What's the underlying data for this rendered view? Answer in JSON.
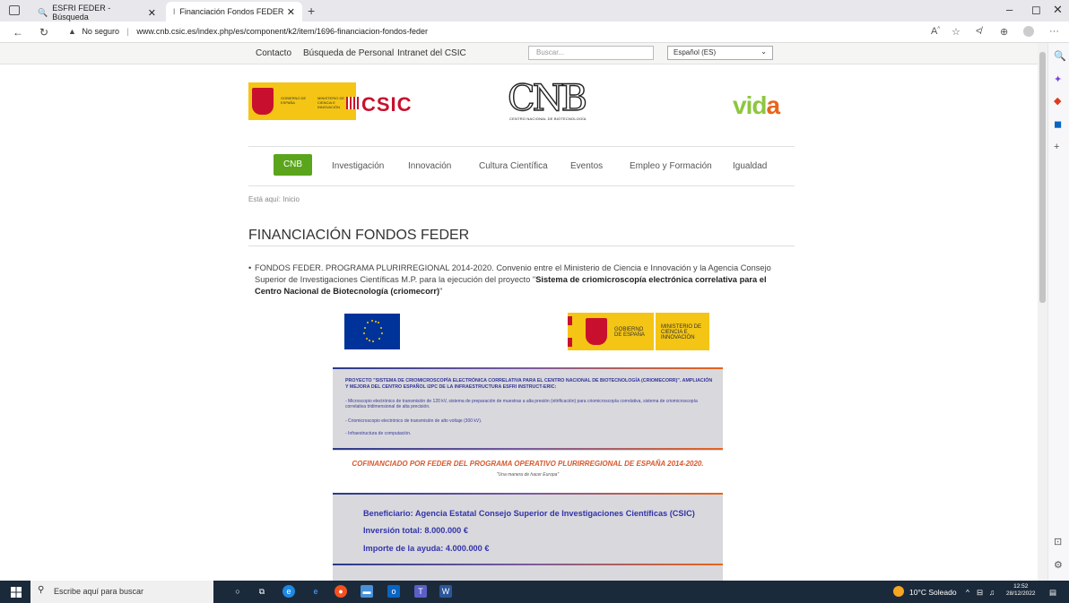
{
  "browser": {
    "tabs": [
      {
        "title": "ESFRI FEDER - Búsqueda"
      },
      {
        "title": "Financiación Fondos FEDER"
      }
    ],
    "security_label": "No seguro",
    "url": "www.cnb.csic.es/index.php/es/component/k2/item/1696-financiacion-fondos-feder"
  },
  "topnav": {
    "links": [
      "Contacto",
      "Búsqueda de Personal",
      "Intranet del CSIC"
    ],
    "search_placeholder": "Buscar...",
    "language": "Español (ES)"
  },
  "logos": {
    "gobierno": "GOBIERNO DE ESPAÑA",
    "ministerio": "MINISTERIO DE CIENCIA E INNOVACIÓN",
    "csic": "CSIC",
    "cnb": "CNB",
    "cnb_sub": "CENTRO NACIONAL DE BIOTECNOLOGÍA",
    "vida_v": "vid",
    "vida_a": "a"
  },
  "menu": [
    "CNB",
    "Investigación",
    "Innovación",
    "Cultura Científica",
    "Eventos",
    "Empleo y Formación",
    "Igualdad"
  ],
  "breadcrumb": {
    "label": "Está aquí:",
    "home": "Inicio"
  },
  "page": {
    "title": "FINANCIACIÓN FONDOS FEDER",
    "bullet_text": "FONDOS FEDER. PROGRAMA PLURIRREGIONAL 2014-2020. Convenio entre el Ministerio de Ciencia e Innovación y la Agencia Consejo Superior de Investigaciones Científicas M.P. para la ejecución del proyecto \"",
    "bullet_bold": "Sistema de criomicroscopía electrónica correlativa para el Centro Nacional de Biotecnología (criomecorr)",
    "bullet_end": "\""
  },
  "gob_banner": {
    "gobierno": "GOBIERNO DE ESPAÑA",
    "ministerio": "MINISTERIO DE CIENCIA E INNOVACIÓN"
  },
  "poster": {
    "title": "PROYECTO \"SISTEMA DE CRIOMICROSCOPÍA ELECTRÓNICA CORRELATIVA PARA EL CENTRO NACIONAL DE BIOTECNOLOGÍA (CRIOMECORR)\". AMPLIACIÓN Y MEJORA DEL CENTRO ESPAÑOL I2PC DE LA INFRAESTRUCTURA ESFRI INSTRUCT-ERIC:",
    "items": [
      "- Microscopio electrónico de transmisión de 120 kV, sistema de preparación de muestras a alta presión (vitrificación) para criomicroscopía correlativa, sistema de criomicroscopía correlativa tridimensional de alta precisión.",
      "- Criomicroscopio electrónico de transmisión de alto voltaje (300 kV).",
      "- Infraestructura de computación."
    ],
    "cofinanciado": "COFINANCIADO POR FEDER DEL PROGRAMA OPERATIVO PLURIRREGIONAL DE ESPAÑA 2014-2020.",
    "motto": "\"Una manera de hacer Europa\"",
    "beneficiario": "Beneficiario: Agencia Estatal Consejo Superior de Investigaciones Científicas (CSIC)",
    "inversion": "Inversión total: 8.000.000 €",
    "ayuda": "Importe de la ayuda: 4.000.000 €"
  },
  "taskbar": {
    "search_placeholder": "Escribe aquí para buscar",
    "weather": "10°C Soleado",
    "time": "12:52",
    "date": "28/12/2022"
  },
  "colors": {
    "accent_green": "#5aa51c",
    "poster_blue": "#3333aa",
    "poster_orange": "#d9572b"
  }
}
